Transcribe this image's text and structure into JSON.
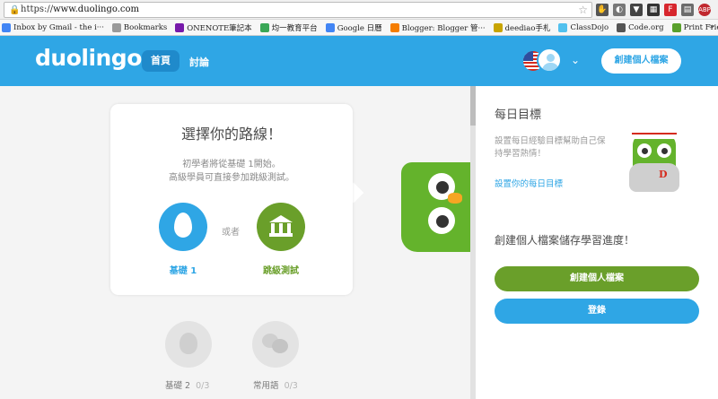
{
  "browser": {
    "url_scheme": "https://",
    "url_host": "www.duolingo.com",
    "bookmarks": [
      {
        "label": "Inbox by Gmail - the i···",
        "color": "#4285f4"
      },
      {
        "label": "Bookmarks",
        "color": "#9a9a9a"
      },
      {
        "label": "ONENOTE筆記本",
        "color": "#7719aa"
      },
      {
        "label": "均一教育平台",
        "color": "#3aa757"
      },
      {
        "label": "Google 日曆",
        "color": "#4285f4"
      },
      {
        "label": "Blogger: Blogger 管···",
        "color": "#f57d00"
      },
      {
        "label": "deediao手札",
        "color": "#c8a400"
      },
      {
        "label": "ClassDojo",
        "color": "#52c1ee"
      },
      {
        "label": "Code.org",
        "color": "#555555"
      },
      {
        "label": "Print Friendly & PDF",
        "color": "#5aa02c"
      }
    ],
    "more": "»"
  },
  "header": {
    "logo": "duolingo",
    "nav_home": "首頁",
    "nav_discussion": "討論",
    "create_profile": "創建個人檔案"
  },
  "course": {
    "card_title": "選擇你的路線！",
    "card_desc_line1": "初學者將從基礎 1開始。",
    "card_desc_line2": "高級學員可直接參加跳級測試。",
    "or": "或者",
    "basic_label": "基礎 1",
    "test_label": "跳級測試",
    "locked_skills": [
      {
        "name": "基礎 2",
        "progress": "0/3"
      },
      {
        "name": "常用語",
        "progress": "0/3"
      }
    ]
  },
  "sidebar": {
    "daily_title": "每日目標",
    "daily_desc": "設置每日經驗目標幫助自己保持學習熱情！",
    "daily_link": "設置你的每日目標",
    "coach_letter": "D",
    "save_title": "創建個人檔案儲存學習進度！",
    "create_button": "創建個人檔案",
    "login_button": "登錄"
  },
  "colors": {
    "brand_blue": "#2fa6e5",
    "brand_green": "#6a9f2a",
    "owl_green": "#64b32c"
  }
}
